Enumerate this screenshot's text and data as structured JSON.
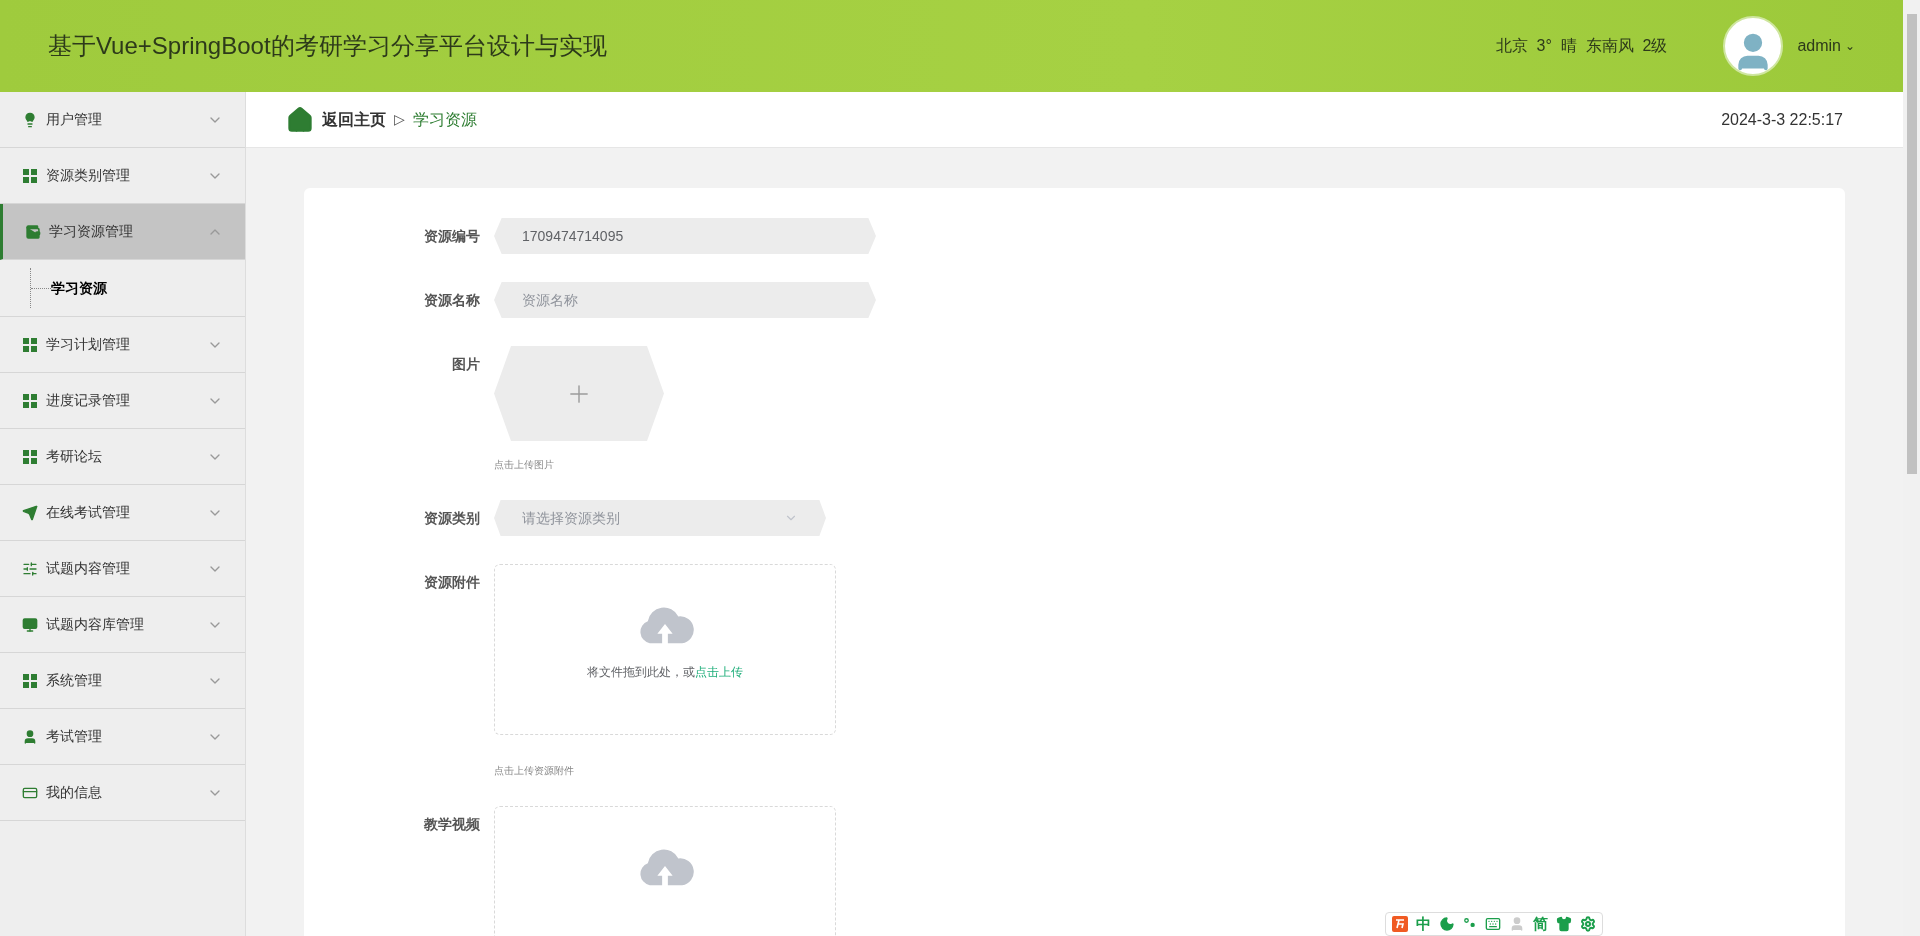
{
  "header": {
    "title": "基于Vue+SpringBoot的考研学习分享平台设计与实现",
    "weather": "北京  3°  晴  东南风  2级",
    "user": {
      "name": "admin",
      "caret": "⌄"
    }
  },
  "sidebar": {
    "items": [
      {
        "label": "用户管理",
        "kind": "bulb",
        "expanded": false,
        "selected": false
      },
      {
        "label": "资源类别管理",
        "kind": "grid",
        "expanded": false,
        "selected": false
      },
      {
        "label": "学习资源管理",
        "kind": "wallet",
        "expanded": true,
        "selected": true,
        "children": [
          {
            "label": "学习资源",
            "selected": true
          }
        ]
      },
      {
        "label": "学习计划管理",
        "kind": "grid",
        "expanded": false,
        "selected": false
      },
      {
        "label": "进度记录管理",
        "kind": "grid",
        "expanded": false,
        "selected": false
      },
      {
        "label": "考研论坛",
        "kind": "grid",
        "expanded": false,
        "selected": false
      },
      {
        "label": "在线考试管理",
        "kind": "plane",
        "expanded": false,
        "selected": false
      },
      {
        "label": "试题内容管理",
        "kind": "sliders",
        "expanded": false,
        "selected": false
      },
      {
        "label": "试题内容库管理",
        "kind": "monitor",
        "expanded": false,
        "selected": false
      },
      {
        "label": "系统管理",
        "kind": "grid",
        "expanded": false,
        "selected": false
      },
      {
        "label": "考试管理",
        "kind": "user",
        "expanded": false,
        "selected": false
      },
      {
        "label": "我的信息",
        "kind": "card",
        "expanded": false,
        "selected": false
      }
    ]
  },
  "breadcrumb": {
    "home": "返回主页",
    "separator": "▷",
    "current": "学习资源"
  },
  "datetime": "2024-3-3 22:5:17",
  "form": {
    "fields": [
      {
        "kind": "text",
        "label": "资源编号",
        "value": "1709474714095"
      },
      {
        "kind": "text",
        "label": "资源名称",
        "placeholder": "资源名称"
      },
      {
        "kind": "image",
        "label": "图片",
        "hint": "点击上传图片"
      },
      {
        "kind": "select",
        "label": "资源类别",
        "placeholder": "请选择资源类别"
      },
      {
        "kind": "dropzone",
        "label": "资源附件",
        "prompt": "将文件拖到此处，或",
        "link": "点击上传",
        "hint": "点击上传资源附件"
      },
      {
        "kind": "dropzone",
        "label": "教学视频"
      }
    ]
  },
  "ime_toolbar": {
    "items": [
      {
        "kind": "logo"
      },
      {
        "kind": "text",
        "text": "中"
      },
      {
        "kind": "moon"
      },
      {
        "kind": "punct"
      },
      {
        "kind": "keyboard"
      },
      {
        "kind": "person"
      },
      {
        "kind": "text",
        "text": "简"
      },
      {
        "kind": "shirt"
      },
      {
        "kind": "gear"
      }
    ]
  }
}
